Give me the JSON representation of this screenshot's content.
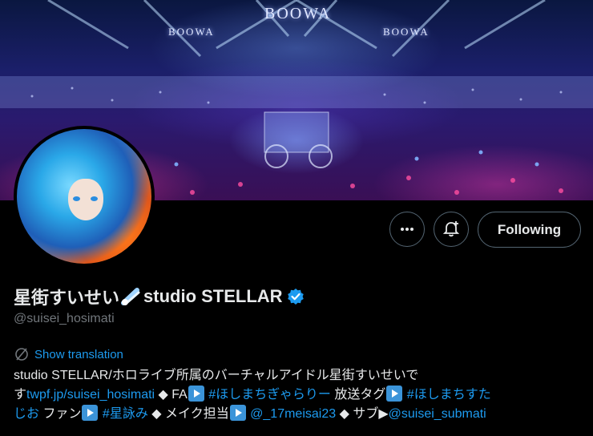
{
  "banner": {
    "sign_center": "BOOWA",
    "sign_left": "BOOWA",
    "sign_right": "BOOWA"
  },
  "profile": {
    "display_name_part1": "星街すいせい",
    "display_name_part2": "studio STELLAR",
    "handle": "@suisei_hosimati",
    "verified": true,
    "comet_emoji": "☄"
  },
  "actions": {
    "more_icon": "more-icon",
    "notify_icon": "bell-plus-icon",
    "following_label": "Following"
  },
  "translate": {
    "label": "Show translation"
  },
  "bio": {
    "t1": "studio STELLAR/ホロライブ所属のバーチャルアイドル星街すいせいで",
    "t2": "す",
    "link_site": "twpf.jp/suisei_hosimati",
    "t3": " ◆ FA",
    "hashtag_fa": " #ほしまちぎゃらりー",
    "t4": " 放送タグ",
    "hashtag_stream": " #ほしまちすた",
    "hashtag_stream2": "じお",
    "t5": " ファン",
    "hashtag_fan": " #星詠み",
    "t6": " ◆ メイク担当",
    "mention_make": " @_17meisai23",
    "t7": " ◆ サブ▶",
    "mention_sub": "@suisei_submati"
  },
  "colors": {
    "accent": "#1d9bf0",
    "background": "#000000",
    "text": "#e7e9ea",
    "muted": "#71767b",
    "border": "#536471"
  }
}
